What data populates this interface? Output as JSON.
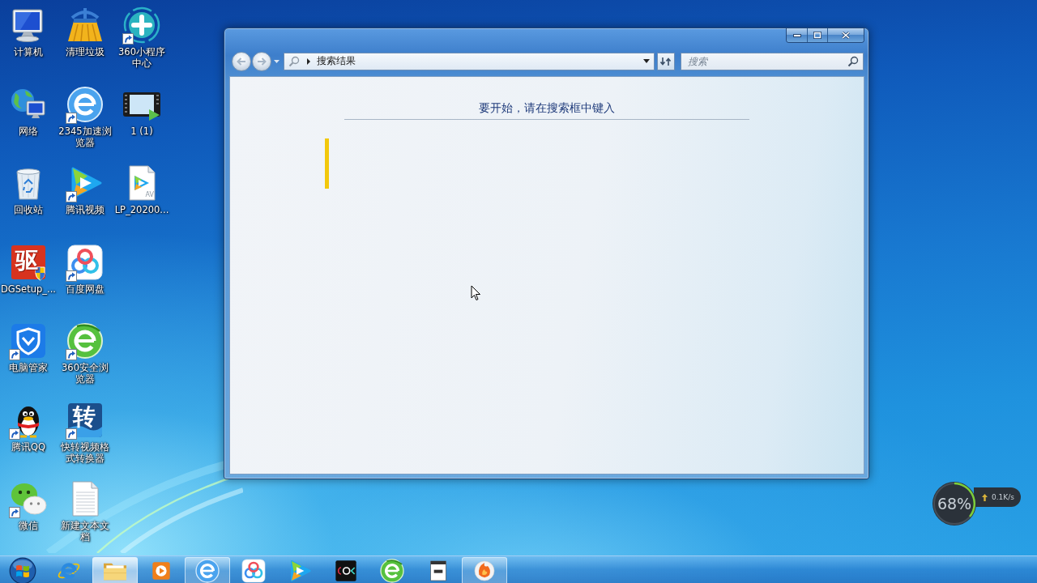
{
  "desktop_icons": [
    {
      "label": "计算机",
      "shortcut": false
    },
    {
      "label": "网络",
      "shortcut": false
    },
    {
      "label": "回收站",
      "shortcut": false
    },
    {
      "label": "DGSetup_...",
      "shortcut": false,
      "icon_text": "驱"
    },
    {
      "label": "电脑管家",
      "shortcut": true
    },
    {
      "label": "腾讯QQ",
      "shortcut": true
    },
    {
      "label": "微信",
      "shortcut": true
    },
    {
      "label": "清理垃圾",
      "shortcut": false
    },
    {
      "label": "2345加速浏览器",
      "shortcut": true
    },
    {
      "label": "腾讯视频",
      "shortcut": true
    },
    {
      "label": "百度网盘",
      "shortcut": true
    },
    {
      "label": "360安全浏览器",
      "shortcut": true
    },
    {
      "label": "快转视频格式转换器",
      "shortcut": true,
      "icon_text": "转"
    },
    {
      "label": "新建文本文档",
      "shortcut": false
    },
    {
      "label": "360小程序中心",
      "shortcut": true
    },
    {
      "label": "1 (1)",
      "shortcut": false
    },
    {
      "label": "LP_20200...",
      "shortcut": false,
      "icon_text": "AV"
    }
  ],
  "window": {
    "nav_buttons": [
      {
        "kind": "back",
        "disabled": true
      },
      {
        "kind": "forward",
        "disabled": true
      }
    ],
    "address_bar": {
      "crumbs": [
        "搜索结果"
      ]
    },
    "search_box": {
      "placeholder": "搜索"
    },
    "message": "要开始，请在搜索框中键入"
  },
  "speed_widget": {
    "percent": "68%",
    "rate": "0.1K/s"
  },
  "taskbar": {
    "items": [
      {
        "open": false,
        "selected": false
      },
      {
        "open": true,
        "selected": true
      },
      {
        "open": false,
        "selected": false
      },
      {
        "open": true,
        "selected": false
      },
      {
        "open": false,
        "selected": false
      },
      {
        "open": false,
        "selected": false
      },
      {
        "open": false,
        "selected": false
      },
      {
        "open": false,
        "selected": false
      },
      {
        "open": false,
        "selected": false
      },
      {
        "open": true,
        "selected": false
      }
    ]
  }
}
